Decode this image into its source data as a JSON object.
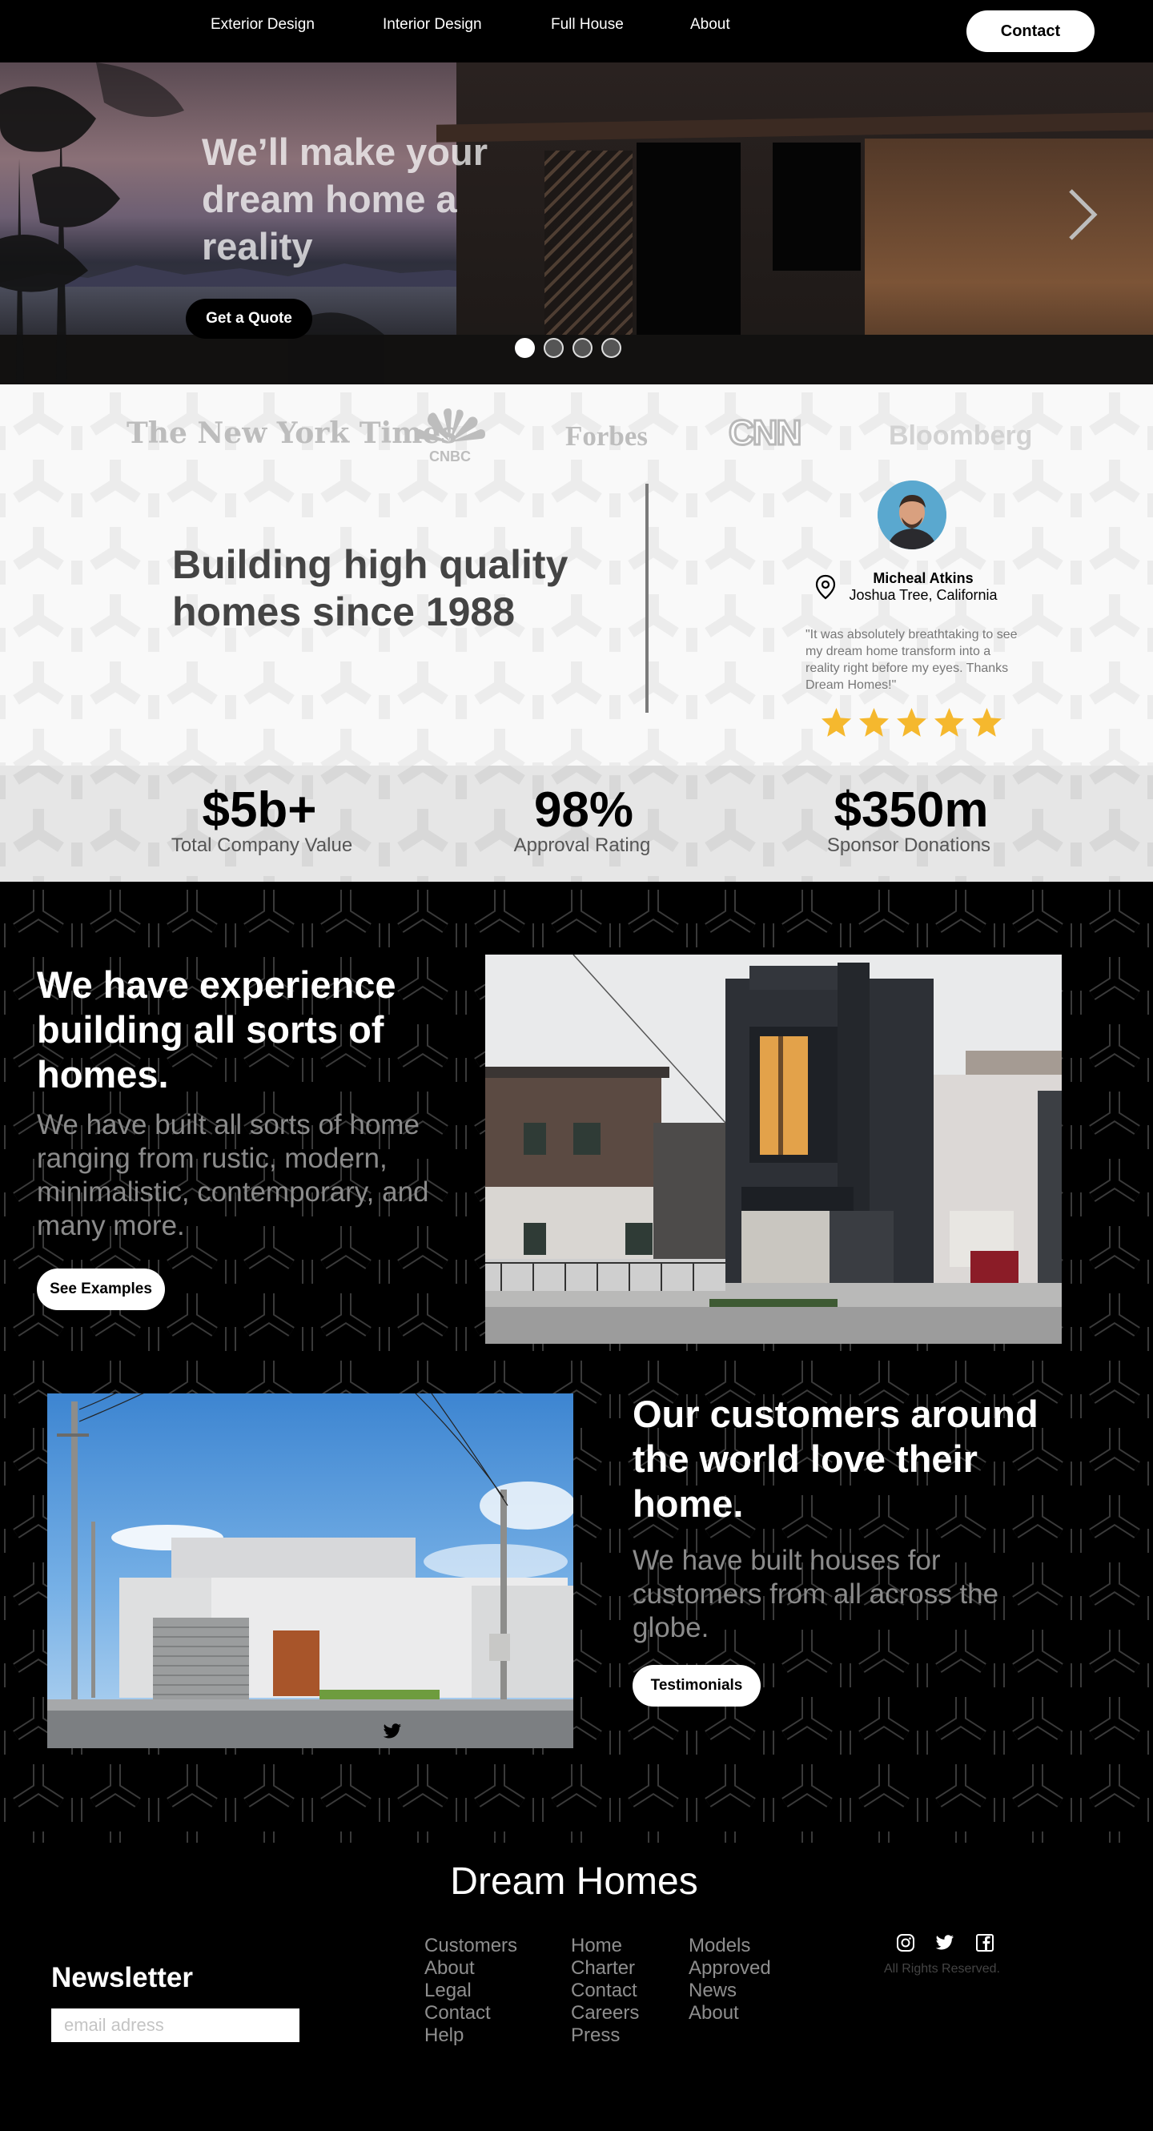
{
  "nav": {
    "links": [
      "Exterior Design",
      "Interior Design",
      "Full House",
      "About"
    ],
    "contact_label": "Contact"
  },
  "hero": {
    "title": "We’ll make your dream home a reality",
    "cta_label": "Get a Quote",
    "slide_count": 4,
    "active_slide": 1
  },
  "press": {
    "logos": [
      "The New York Times",
      "CNBC",
      "Forbes",
      "CNN",
      "Bloomberg"
    ]
  },
  "about": {
    "title": "Building high quality homes since 1988"
  },
  "testimonial": {
    "name": "Micheal Atkins",
    "location": "Joshua Tree, California",
    "quote": "\"It was absolutely breathtaking to see my dream home transform into a reality right before my eyes. Thanks Dream Homes!\"",
    "rating": 5,
    "star_color": "#f5b82e"
  },
  "stats": [
    {
      "value": "$5b+",
      "label": "Total Company Value"
    },
    {
      "value": "98%",
      "label": "Approval Rating"
    },
    {
      "value": "$350m",
      "label": "Sponsor Donations"
    }
  ],
  "experience": {
    "title": "We have experience building all sorts of homes.",
    "text": "We have built all sorts of home ranging from rustic, modern, minimalistic, contemporary, and many more.",
    "button_label": "See Examples"
  },
  "customers": {
    "title": "Our customers around the world love their home.",
    "text": "We have built houses for customers from all across the globe.",
    "button_label": "Testimonials"
  },
  "footer": {
    "brand": "Dream Homes",
    "newsletter_title": "Newsletter",
    "newsletter_placeholder": "email adress",
    "col1": [
      "Customers",
      "About",
      "Legal",
      "Contact",
      "Help"
    ],
    "col2": [
      "Home",
      "Charter",
      "Contact",
      "Careers",
      "Press"
    ],
    "col3": [
      "Models",
      "Approved",
      "News",
      "About"
    ],
    "social_icons": [
      "instagram-icon",
      "twitter-icon",
      "facebook-icon"
    ],
    "rights": "All Rights Reserved."
  },
  "colors": {
    "background": "#000000",
    "accent_star": "#f5b82e",
    "light_band": "#e6e6e6"
  }
}
